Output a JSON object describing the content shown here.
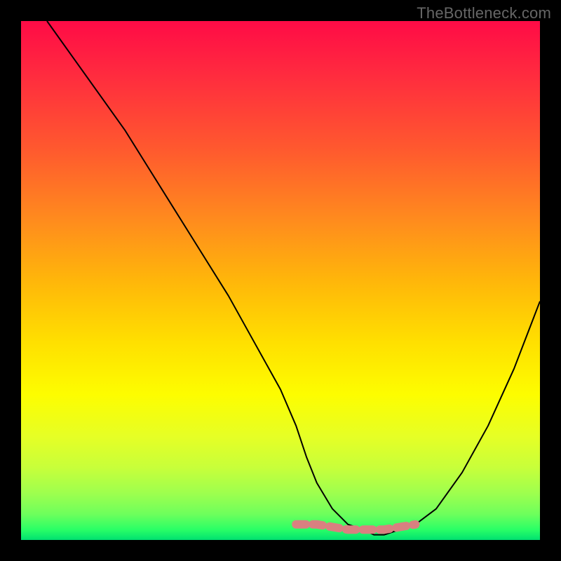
{
  "watermark": "TheBottleneck.com",
  "chart_data": {
    "type": "line",
    "title": "",
    "xlabel": "",
    "ylabel": "",
    "xlim": [
      0,
      100
    ],
    "ylim": [
      0,
      100
    ],
    "series": [
      {
        "name": "curve",
        "x": [
          5,
          10,
          15,
          20,
          25,
          30,
          35,
          40,
          45,
          50,
          53,
          55,
          57,
          60,
          63,
          66,
          68,
          70,
          73,
          76,
          80,
          85,
          90,
          95,
          100
        ],
        "y": [
          100,
          93,
          86,
          79,
          71,
          63,
          55,
          47,
          38,
          29,
          22,
          16,
          11,
          6,
          3,
          2,
          1,
          1,
          2,
          3,
          6,
          13,
          22,
          33,
          46
        ]
      },
      {
        "name": "marker-band",
        "x": [
          53,
          55,
          57,
          60,
          63,
          66,
          68,
          70,
          73,
          76
        ],
        "y": [
          3,
          3,
          3,
          2.5,
          2,
          2,
          2,
          2,
          2.5,
          3
        ]
      }
    ],
    "annotations": [],
    "colors": {
      "curve": "#000000",
      "marker": "#d98080",
      "gradient_top": "#ff0b46",
      "gradient_bottom": "#00e070",
      "frame_bg": "#000000"
    }
  }
}
